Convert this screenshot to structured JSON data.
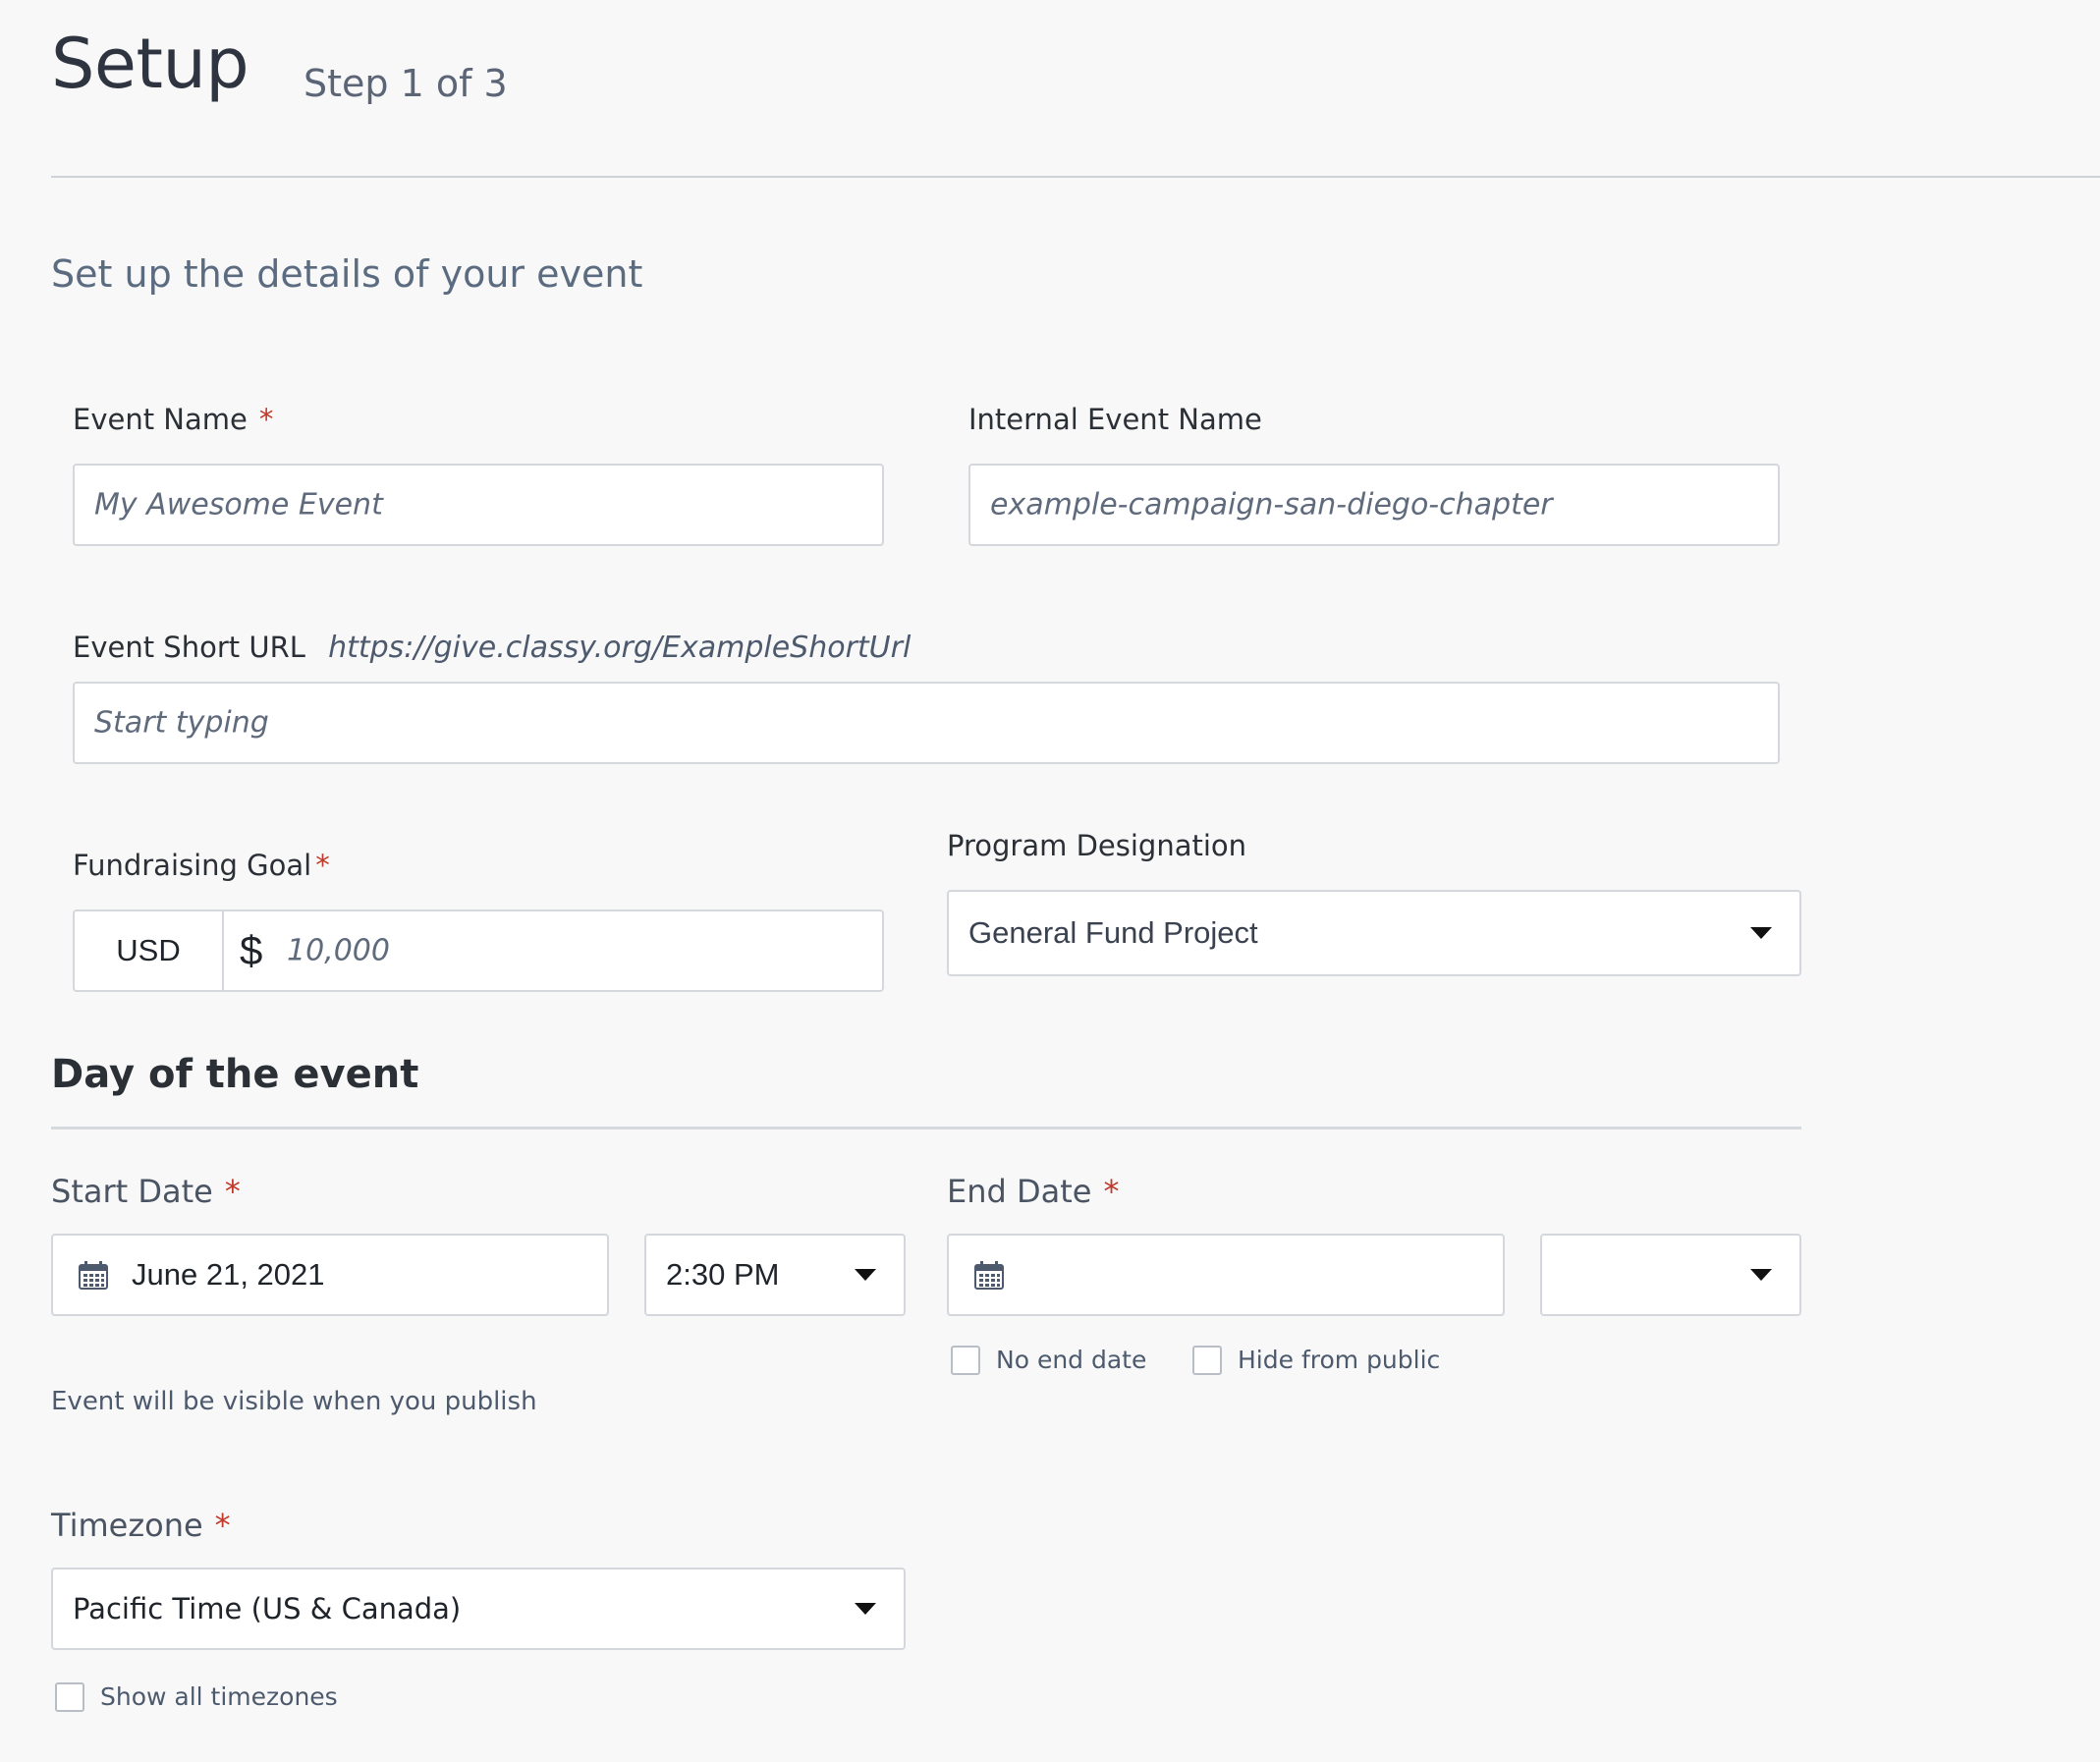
{
  "header": {
    "title": "Setup",
    "step": "Step 1 of 3",
    "subtitle": "Set up the details of your event"
  },
  "form": {
    "event_name": {
      "label": "Event Name",
      "required_mark": "*",
      "placeholder": "My Awesome Event"
    },
    "internal_event_name": {
      "label": "Internal Event Name",
      "placeholder": "example-campaign-san-diego-chapter"
    },
    "short_url": {
      "label": "Event Short URL",
      "url_preview": "https://give.classy.org/ExampleShortUrl",
      "placeholder": "Start typing"
    },
    "fundraising_goal": {
      "label": "Fundraising Goal",
      "required_mark": "*",
      "currency": "USD",
      "symbol": "$",
      "placeholder": "10,000"
    },
    "program_designation": {
      "label": "Program Designation",
      "selected": "General Fund Project"
    }
  },
  "day_of_event": {
    "title": "Day of the event",
    "start_date": {
      "label": "Start Date",
      "required_mark": "*",
      "date": "June 21, 2021",
      "time": "2:30 PM"
    },
    "end_date": {
      "label": "End Date",
      "required_mark": "*",
      "date": "",
      "time": ""
    },
    "no_end_date_label": "No end date",
    "hide_from_public_label": "Hide from public",
    "visibility_help": "Event will be visible when you publish",
    "timezone": {
      "label": "Timezone",
      "required_mark": "*",
      "selected": "Pacific Time (US & Canada)"
    },
    "show_all_timezones_label": "Show all timezones"
  },
  "icons": {
    "calendar": "calendar-icon",
    "dropdown": "chevron-down-icon"
  },
  "colors": {
    "background": "#f8f8f8",
    "required": "#c0392b",
    "border": "#d4d8dd",
    "muted_text": "#5b6b80"
  }
}
